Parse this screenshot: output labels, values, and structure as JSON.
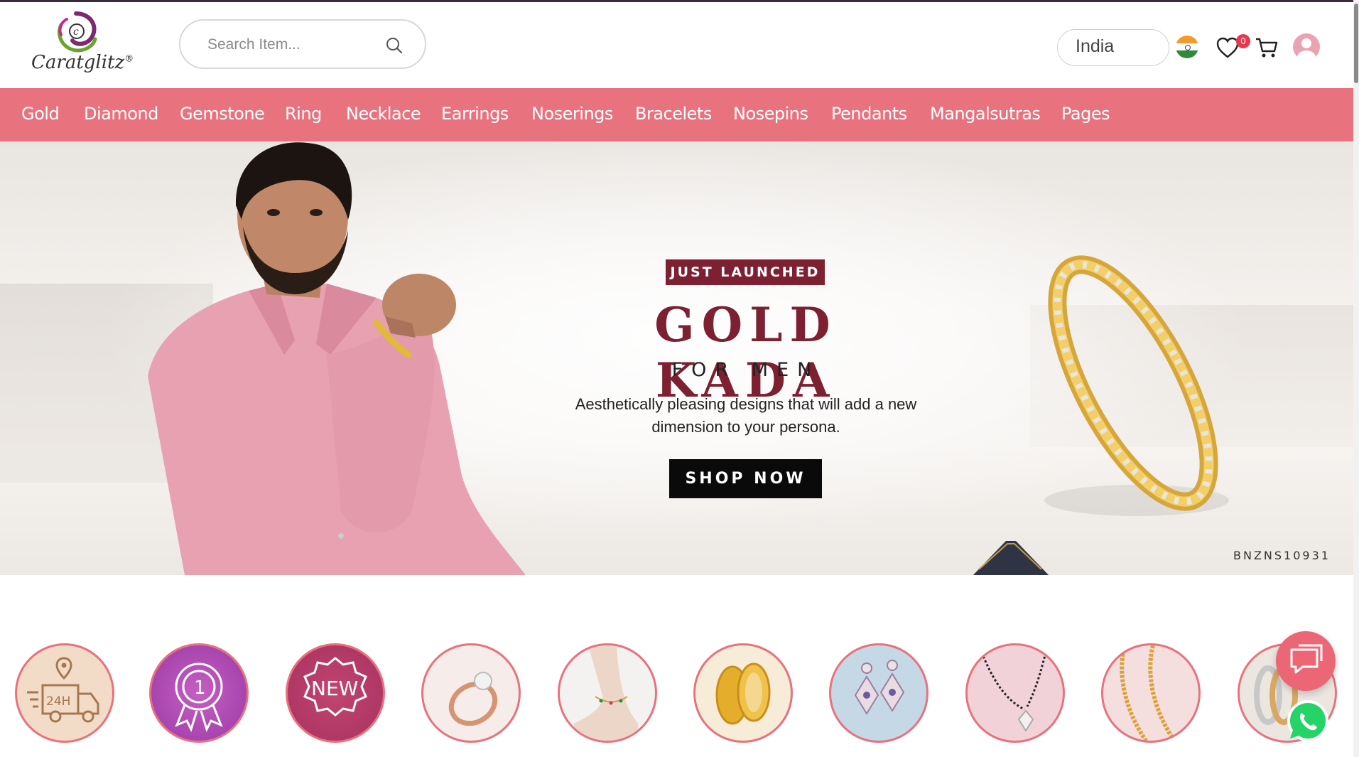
{
  "brand": {
    "name": "Caratglitz",
    "reg_mark": "®",
    "colors": {
      "nav_bg": "#e8727e",
      "maroon": "#7c2032",
      "badge": "#e8384f"
    }
  },
  "search": {
    "placeholder": "Search Item..."
  },
  "header": {
    "country": "India",
    "wishlist_count": "0",
    "icons": [
      "search-icon",
      "india-flag-icon",
      "heart-icon",
      "cart-icon",
      "user-avatar-icon"
    ]
  },
  "nav": {
    "items": [
      {
        "label": "Gold"
      },
      {
        "label": "Diamond"
      },
      {
        "label": "Gemstone"
      },
      {
        "label": "Ring"
      },
      {
        "label": "Necklace"
      },
      {
        "label": "Earrings"
      },
      {
        "label": "Noserings"
      },
      {
        "label": "Bracelets"
      },
      {
        "label": "Nosepins"
      },
      {
        "label": "Pendants"
      },
      {
        "label": "Mangalsutras"
      },
      {
        "label": "Pages"
      }
    ]
  },
  "hero": {
    "tag": "JUST LAUNCHED",
    "title": "GOLD KADA",
    "subtitle": "FOR MEN",
    "description": "Aesthetically pleasing designs that will add a new dimension to your persona.",
    "cta": "SHOP NOW",
    "product_code": "BNZNS10931"
  },
  "categories": {
    "items": [
      {
        "icon": "delivery-24h-icon",
        "text": "24H"
      },
      {
        "icon": "award-ribbon-icon",
        "text": "1"
      },
      {
        "icon": "new-badge-icon",
        "text": "NEW"
      },
      {
        "icon": "ring-image"
      },
      {
        "icon": "anklet-image"
      },
      {
        "icon": "gold-bangles-image"
      },
      {
        "icon": "earrings-image"
      },
      {
        "icon": "mangalsutra-image"
      },
      {
        "icon": "gold-chain-image"
      },
      {
        "icon": "band-rings-image"
      }
    ]
  },
  "floating": {
    "chat_icon": "chat-icon",
    "whatsapp_icon": "whatsapp-icon"
  }
}
